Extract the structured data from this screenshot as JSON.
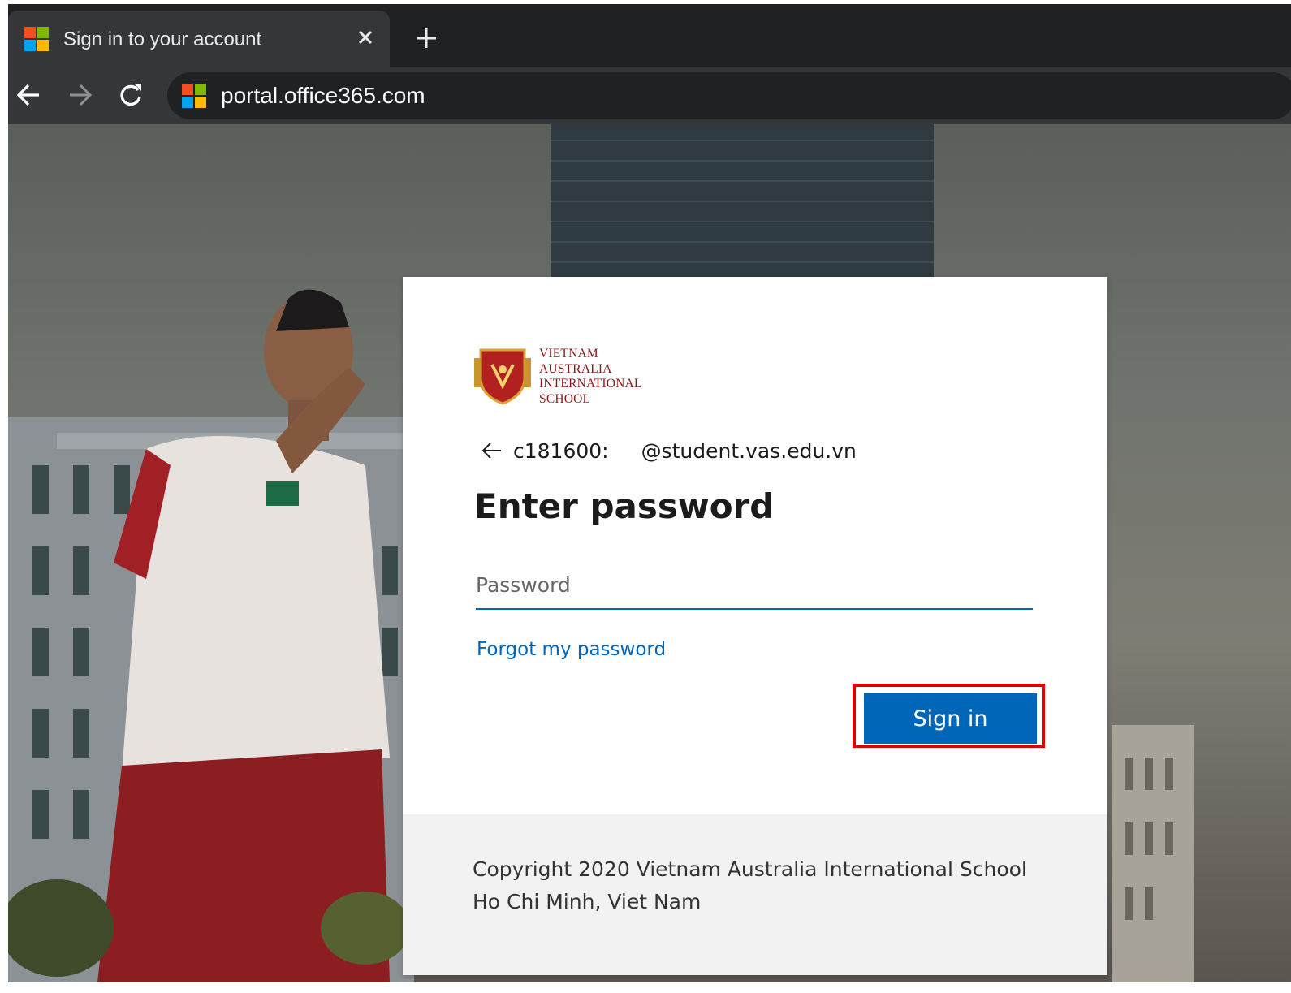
{
  "browser": {
    "tab": {
      "title": "Sign in to your account",
      "favicon": "microsoft-logo-icon",
      "close_icon": "close-icon"
    },
    "new_tab_icon": "plus-icon",
    "nav": {
      "back_icon": "back-arrow-icon",
      "forward_icon": "forward-arrow-icon",
      "reload_icon": "reload-icon"
    },
    "address_bar": {
      "url": "portal.office365.com",
      "favicon": "microsoft-logo-icon"
    }
  },
  "signin": {
    "logo_lines": [
      "VIETNAM",
      "AUSTRALIA",
      "INTERNATIONAL",
      "SCHOOL"
    ],
    "identity": {
      "user_prefix": "c181600:",
      "domain": "@student.vas.edu.vn"
    },
    "title": "Enter password",
    "password": {
      "placeholder": "Password",
      "value": ""
    },
    "forgot_link": "Forgot my password",
    "signin_button": "Sign in",
    "footer": {
      "copyright": "Copyright 2020 Vietnam Australia International School Ho Chi Minh, Viet Nam"
    }
  },
  "colors": {
    "accent": "#0067b8",
    "highlight": "#e00000",
    "brand_red": "#8b1a1a"
  }
}
